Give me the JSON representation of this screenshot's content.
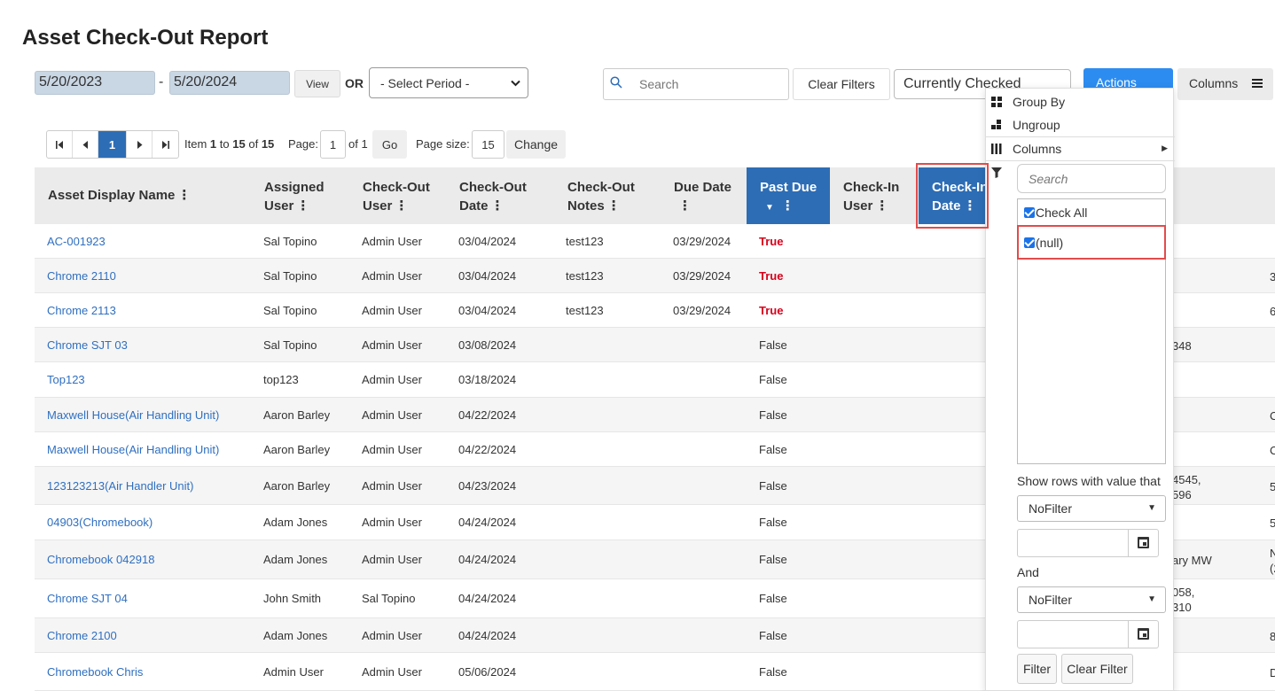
{
  "page": {
    "title": "Asset Check-Out Report"
  },
  "toolbar": {
    "date_from": "5/20/2023",
    "date_sep": "-",
    "date_to": "5/20/2024",
    "view_label": "View",
    "or_label": "OR",
    "period_select": "- Select Period -",
    "search_placeholder": "Search",
    "clear_filters_label": "Clear Filters",
    "status_select": "Currently Checked",
    "actions_label": "Actions",
    "columns_label": "Columns"
  },
  "pager": {
    "current_page": "1",
    "item_prefix": "Item",
    "item_from": "1",
    "item_to_word": "to",
    "item_to": "15",
    "item_of_word": "of",
    "item_total": "15",
    "page_label": "Page:",
    "page_value": "1",
    "of_pages": "of 1",
    "go_label": "Go",
    "page_size_label": "Page size:",
    "page_size_value": "15",
    "change_label": "Change"
  },
  "table": {
    "headers": {
      "asset": "Asset Display Name",
      "assigned_1": "Assigned",
      "assigned_2": "User",
      "checkout_user_1": "Check-Out",
      "checkout_user_2": "User",
      "checkout_date_1": "Check-Out",
      "checkout_date_2": "Date",
      "checkout_notes_1": "Check-Out",
      "checkout_notes_2": "Notes",
      "due_date": "Due Date",
      "past_due": "Past Due",
      "checkin_user_1": "Check-In",
      "checkin_user_2": "User",
      "checkin_date_1": "Check-In",
      "checkin_date_2": "Date"
    },
    "rows": [
      {
        "asset": "AC-001923",
        "assigned": "Sal Topino",
        "co_user": "Admin User",
        "co_date": "03/04/2024",
        "notes": "test123",
        "due": "03/29/2024",
        "past_due": "True",
        "extra1": "",
        "extra2": ""
      },
      {
        "asset": "Chrome 2110",
        "assigned": "Sal Topino",
        "co_user": "Admin User",
        "co_date": "03/04/2024",
        "notes": "test123",
        "due": "03/29/2024",
        "past_due": "True",
        "extra1": "",
        "extra2": "3"
      },
      {
        "asset": "Chrome 2113",
        "assigned": "Sal Topino",
        "co_user": "Admin User",
        "co_date": "03/04/2024",
        "notes": "test123",
        "due": "03/29/2024",
        "past_due": "True",
        "extra1": "",
        "extra2": "6"
      },
      {
        "asset": "Chrome SJT 03",
        "assigned": "Sal Topino",
        "co_user": "Admin User",
        "co_date": "03/08/2024",
        "notes": "",
        "due": "",
        "past_due": "False",
        "extra1": "348",
        "extra2": ""
      },
      {
        "asset": "Top123",
        "assigned": "top123",
        "co_user": "Admin User",
        "co_date": "03/18/2024",
        "notes": "",
        "due": "",
        "past_due": "False",
        "extra1": "",
        "extra2": ""
      },
      {
        "asset": "Maxwell House(Air Handling Unit)",
        "assigned": "Aaron Barley",
        "co_user": "Admin User",
        "co_date": "04/22/2024",
        "notes": "",
        "due": "",
        "past_due": "False",
        "extra1": "",
        "extra2": "C"
      },
      {
        "asset": "Maxwell House(Air Handling Unit)",
        "assigned": "Aaron Barley",
        "co_user": "Admin User",
        "co_date": "04/22/2024",
        "notes": "",
        "due": "",
        "past_due": "False",
        "extra1": "",
        "extra2": "C"
      },
      {
        "asset": "123123213(Air Handler Unit)",
        "assigned": "Aaron Barley",
        "co_user": "Admin User",
        "co_date": "04/23/2024",
        "notes": "",
        "due": "",
        "past_due": "False",
        "extra1": "4545,",
        "extra1b": "596",
        "extra2": "5"
      },
      {
        "asset": "04903(Chromebook)",
        "assigned": "Adam Jones",
        "co_user": "Admin User",
        "co_date": "04/24/2024",
        "notes": "",
        "due": "",
        "past_due": "False",
        "extra1": "",
        "extra2": "5"
      },
      {
        "asset": "Chromebook 042918",
        "assigned": "Adam Jones",
        "co_user": "Admin User",
        "co_date": "04/24/2024",
        "notes": "",
        "due": "",
        "past_due": "False",
        "extra1": "ary MW",
        "extra2": "N",
        "extra2b": "(2"
      },
      {
        "asset": "Chrome SJT 04",
        "assigned": "John Smith",
        "co_user": "Sal Topino",
        "co_date": "04/24/2024",
        "notes": "",
        "due": "",
        "past_due": "False",
        "extra1": "058,",
        "extra1b": "310",
        "extra2": ""
      },
      {
        "asset": "Chrome 2100",
        "assigned": "Adam Jones",
        "co_user": "Admin User",
        "co_date": "04/24/2024",
        "notes": "",
        "due": "",
        "past_due": "False",
        "extra1": "",
        "extra2": "8"
      },
      {
        "asset": "Chromebook Chris",
        "assigned": "Admin User",
        "co_user": "Admin User",
        "co_date": "05/06/2024",
        "notes": "",
        "due": "",
        "past_due": "False",
        "extra1": "",
        "extra2": "D"
      }
    ]
  },
  "menu": {
    "group_by": "Group By",
    "ungroup": "Ungroup",
    "columns": "Columns",
    "filter_search_placeholder": "Search",
    "check_all": "Check All",
    "null_option": "(null)",
    "show_rows_label": "Show rows with value that",
    "op1": "NoFilter",
    "and_label": "And",
    "op2": "NoFilter",
    "filter_btn": "Filter",
    "clear_filter_btn": "Clear Filter"
  },
  "colors": {
    "accent": "#2d6db5",
    "link": "#2f6fc0",
    "past_due_true": "#d9001b",
    "highlight_box": "#e24b4b",
    "actions": "#2d8cf0"
  }
}
